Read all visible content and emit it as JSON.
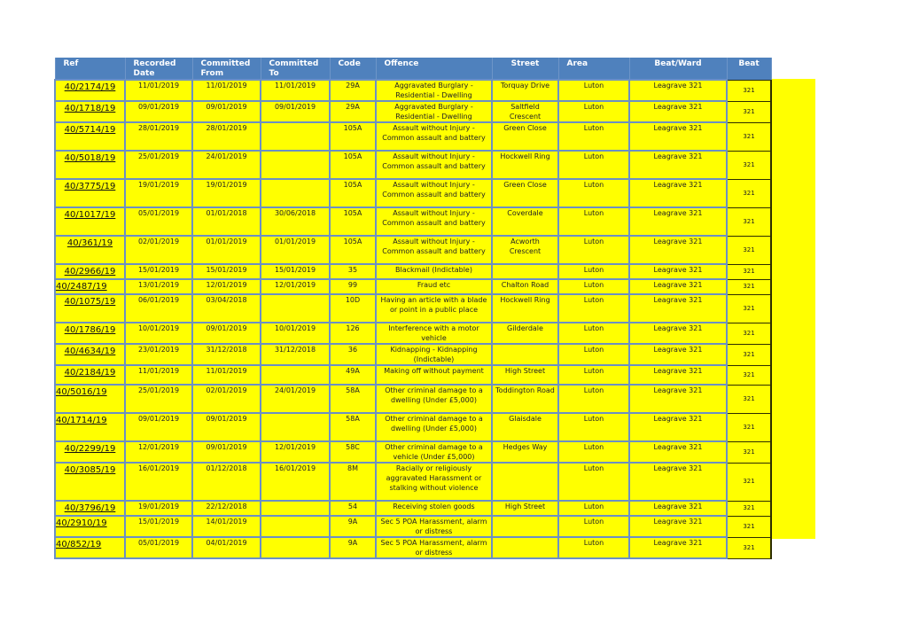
{
  "columns": [
    "Ref",
    "Recorded Date",
    "Committed From",
    "Committed To",
    "Code",
    "Offence",
    "Street",
    "Area",
    "Beat/Ward",
    "Beat"
  ],
  "colors": {
    "header_bg": "#4f81bd",
    "cell_bg": "#ffff00",
    "grid": "#6c90c3"
  },
  "rows": [
    {
      "ref": "40/2174/19",
      "recorded": "11/01/2019",
      "from": "11/01/2019",
      "to": "11/01/2019",
      "code": "29A",
      "offence": "Aggravated Burglary - Residential - Dwelling",
      "street": "Torquay Drive",
      "area": "Luton",
      "ward": "Leagrave 321",
      "beat": "321"
    },
    {
      "ref": "40/1718/19",
      "recorded": "09/01/2019",
      "from": "09/01/2019",
      "to": "09/01/2019",
      "code": "29A",
      "offence": "Aggravated Burglary - Residential - Dwelling",
      "street": "Saltfield Crescent",
      "area": "Luton",
      "ward": "Leagrave 321",
      "beat": "321"
    },
    {
      "ref": "40/5714/19",
      "recorded": "28/01/2019",
      "from": "28/01/2019",
      "to": "",
      "code": "105A",
      "offence": "Assault without Injury - Common assault and battery",
      "street": "Green Close",
      "area": "Luton",
      "ward": "Leagrave 321",
      "beat": "321"
    },
    {
      "ref": "40/5018/19",
      "recorded": "25/01/2019",
      "from": "24/01/2019",
      "to": "",
      "code": "105A",
      "offence": "Assault without Injury - Common assault and battery",
      "street": "Hockwell Ring",
      "area": "Luton",
      "ward": "Leagrave 321",
      "beat": "321"
    },
    {
      "ref": "40/3775/19",
      "recorded": "19/01/2019",
      "from": "19/01/2019",
      "to": "",
      "code": "105A",
      "offence": "Assault without Injury - Common assault and battery",
      "street": "Green Close",
      "area": "Luton",
      "ward": "Leagrave 321",
      "beat": "321"
    },
    {
      "ref": "40/1017/19",
      "recorded": "05/01/2019",
      "from": "01/01/2018",
      "to": "30/06/2018",
      "code": "105A",
      "offence": "Assault without Injury - Common assault and battery",
      "street": "Coverdale",
      "area": "Luton",
      "ward": "Leagrave 321",
      "beat": "321"
    },
    {
      "ref": "40/361/19",
      "recorded": "02/01/2019",
      "from": "01/01/2019",
      "to": "01/01/2019",
      "code": "105A",
      "offence": "Assault without Injury - Common assault and battery",
      "street": "Acworth Crescent",
      "area": "Luton",
      "ward": "Leagrave 321",
      "beat": "321"
    },
    {
      "ref": "40/2966/19",
      "recorded": "15/01/2019",
      "from": "15/01/2019",
      "to": "15/01/2019",
      "code": "35",
      "offence": "Blackmail (Indictable)",
      "street": "",
      "area": "Luton",
      "ward": "Leagrave 321",
      "beat": "321"
    },
    {
      "ref": "40/2487/19",
      "recorded": "13/01/2019",
      "from": "12/01/2019",
      "to": "12/01/2019",
      "code": "99",
      "offence": "Fraud etc",
      "street": "Chalton Road",
      "area": "Luton",
      "ward": "Leagrave 321",
      "beat": "321",
      "left": true
    },
    {
      "ref": "40/1075/19",
      "recorded": "06/01/2019",
      "from": "03/04/2018",
      "to": "",
      "code": "10D",
      "offence": "Having an article with a blade or point in a public place",
      "street": "Hockwell Ring",
      "area": "Luton",
      "ward": "Leagrave 321",
      "beat": "321"
    },
    {
      "ref": "40/1786/19",
      "recorded": "10/01/2019",
      "from": "09/01/2019",
      "to": "10/01/2019",
      "code": "126",
      "offence": "Interference with a motor vehicle",
      "street": "Gilderdale",
      "area": "Luton",
      "ward": "Leagrave 321",
      "beat": "321"
    },
    {
      "ref": "40/4634/19",
      "recorded": "23/01/2019",
      "from": "31/12/2018",
      "to": "31/12/2018",
      "code": "36",
      "offence": "Kidnapping - Kidnapping (Indictable)",
      "street": "",
      "area": "Luton",
      "ward": "Leagrave 321",
      "beat": "321"
    },
    {
      "ref": "40/2184/19",
      "recorded": "11/01/2019",
      "from": "11/01/2019",
      "to": "",
      "code": "49A",
      "offence": "Making off without payment",
      "street": "High Street",
      "area": "Luton",
      "ward": "Leagrave 321",
      "beat": "321"
    },
    {
      "ref": "40/5016/19",
      "recorded": "25/01/2019",
      "from": "02/01/2019",
      "to": "24/01/2019",
      "code": "58A",
      "offence": "Other criminal damage to a dwelling (Under £5,000)",
      "street": "Toddington Road",
      "area": "Luton",
      "ward": "Leagrave 321",
      "beat": "321",
      "left": true
    },
    {
      "ref": "40/1714/19",
      "recorded": "09/01/2019",
      "from": "09/01/2019",
      "to": "",
      "code": "58A",
      "offence": "Other criminal damage to a dwelling (Under £5,000)",
      "street": "Glaisdale",
      "area": "Luton",
      "ward": "Leagrave 321",
      "beat": "321",
      "left": true
    },
    {
      "ref": "40/2299/19",
      "recorded": "12/01/2019",
      "from": "09/01/2019",
      "to": "12/01/2019",
      "code": "58C",
      "offence": "Other criminal damage to a vehicle (Under £5,000)",
      "street": "Hedges Way",
      "area": "Luton",
      "ward": "Leagrave 321",
      "beat": "321"
    },
    {
      "ref": "40/3085/19",
      "recorded": "16/01/2019",
      "from": "01/12/2018",
      "to": "16/01/2019",
      "code": "8M",
      "offence": "Racially or religiously aggravated Harassment or stalking without violence",
      "street": "",
      "area": "Luton",
      "ward": "Leagrave 321",
      "beat": "321"
    },
    {
      "ref": "40/3796/19",
      "recorded": "19/01/2019",
      "from": "22/12/2018",
      "to": "",
      "code": "54",
      "offence": "Receiving stolen goods",
      "street": "High Street",
      "area": "Luton",
      "ward": "Leagrave 321",
      "beat": "321"
    },
    {
      "ref": "40/2910/19",
      "recorded": "15/01/2019",
      "from": "14/01/2019",
      "to": "",
      "code": "9A",
      "offence": "Sec 5 POA Harassment, alarm or distress",
      "street": "",
      "area": "Luton",
      "ward": "Leagrave 321",
      "beat": "321",
      "left": true
    },
    {
      "ref": "40/852/19",
      "recorded": "05/01/2019",
      "from": "04/01/2019",
      "to": "",
      "code": "9A",
      "offence": "Sec 5 POA Harassment, alarm or distress",
      "street": "",
      "area": "Luton",
      "ward": "Leagrave 321",
      "beat": "321",
      "left": true
    }
  ]
}
